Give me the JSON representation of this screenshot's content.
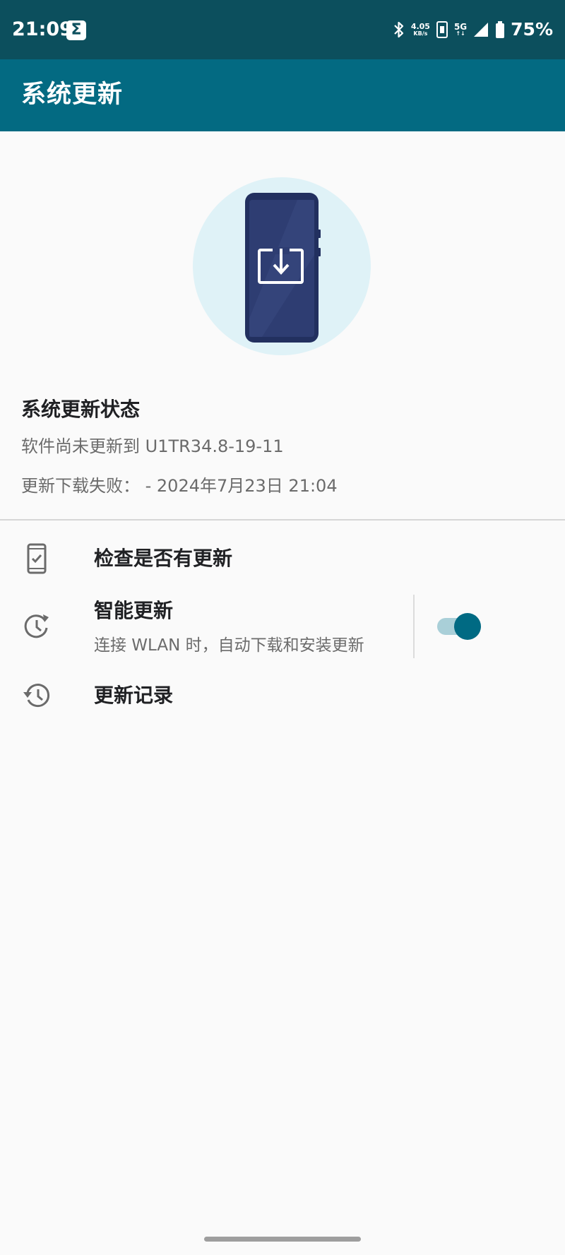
{
  "status_bar": {
    "time": "21:09",
    "notification_icon": "sigma-app-icon",
    "net_speed_value": "4.05",
    "net_speed_unit": "KB/s",
    "network_type": "5G",
    "battery": "75%"
  },
  "app_bar": {
    "title": "系统更新"
  },
  "hero": {
    "icon": "phone-download-illustration"
  },
  "update_status": {
    "title": "系统更新状态",
    "line1": "软件尚未更新到 U1TR34.8-19-11",
    "line2": "更新下载失败： - 2024年7月23日 21:04"
  },
  "menu": {
    "check": {
      "icon": "phone-check-icon",
      "label": "检查是否有更新"
    },
    "smart": {
      "icon": "clock-refresh-icon",
      "label": "智能更新",
      "subtitle": "连接 WLAN 时，自动下载和安装更新",
      "enabled": true
    },
    "history": {
      "icon": "history-icon",
      "label": "更新记录"
    }
  },
  "colors": {
    "status_bar": "#0c4f5d",
    "app_bar": "#036a82",
    "accent": "#006a83",
    "hero_circle": "#dff2f7",
    "phone_body": "#22305f"
  }
}
